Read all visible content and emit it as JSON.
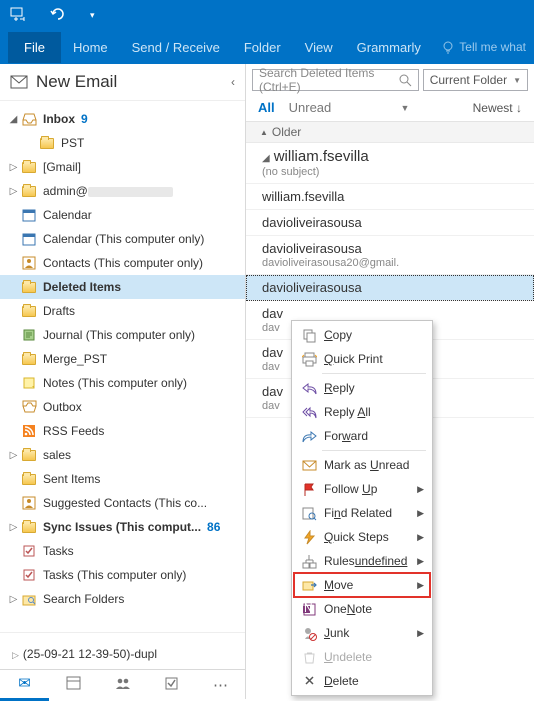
{
  "titlebar": {
    "undo_tip": "Undo",
    "dropdown_tip": "Customize"
  },
  "ribbon": {
    "tabs": {
      "file": "File",
      "home": "Home",
      "sendreceive": "Send / Receive",
      "folder": "Folder",
      "view": "View",
      "grammarly": "Grammarly"
    },
    "tell": "Tell me what"
  },
  "nav": {
    "new_email": "New Email",
    "tree": [
      {
        "id": "inbox",
        "label": "Inbox",
        "badge": "9",
        "depth": 0,
        "twisty": "down",
        "icon": "inbox",
        "bold": true
      },
      {
        "id": "pst",
        "label": "PST",
        "depth": 1,
        "icon": "folder"
      },
      {
        "id": "gmail",
        "label": "[Gmail]",
        "depth": 0,
        "twisty": "right",
        "icon": "folder"
      },
      {
        "id": "admin",
        "label": "admin@",
        "depth": 0,
        "twisty": "right",
        "icon": "folder",
        "redact": 85
      },
      {
        "id": "calendar",
        "label": "Calendar",
        "depth": 0,
        "icon": "calendar"
      },
      {
        "id": "calendar-tco",
        "label": "Calendar (This computer only)",
        "depth": 0,
        "icon": "calendar"
      },
      {
        "id": "contacts-tco",
        "label": "Contacts (This computer only)",
        "depth": 0,
        "icon": "contacts"
      },
      {
        "id": "deleted",
        "label": "Deleted Items",
        "depth": 0,
        "icon": "folder",
        "sel": true,
        "bold": true
      },
      {
        "id": "drafts",
        "label": "Drafts",
        "depth": 0,
        "icon": "folder"
      },
      {
        "id": "journal",
        "label": "Journal (This computer only)",
        "depth": 0,
        "icon": "journal"
      },
      {
        "id": "merge",
        "label": "Merge_PST",
        "depth": 0,
        "icon": "folder"
      },
      {
        "id": "notes",
        "label": "Notes (This computer only)",
        "depth": 0,
        "icon": "notes"
      },
      {
        "id": "outbox",
        "label": "Outbox",
        "depth": 0,
        "icon": "outbox"
      },
      {
        "id": "rss",
        "label": "RSS Feeds",
        "depth": 0,
        "icon": "rss"
      },
      {
        "id": "sales",
        "label": "sales",
        "depth": 0,
        "twisty": "right",
        "icon": "folder"
      },
      {
        "id": "sent",
        "label": "Sent Items",
        "depth": 0,
        "icon": "folder"
      },
      {
        "id": "suggested",
        "label": "Suggested Contacts (This co...",
        "depth": 0,
        "icon": "contacts"
      },
      {
        "id": "sync",
        "label": "Sync Issues (This comput...",
        "badge": "86",
        "depth": 0,
        "twisty": "right",
        "icon": "folder",
        "bold": true
      },
      {
        "id": "tasks",
        "label": "Tasks",
        "depth": 0,
        "icon": "tasks"
      },
      {
        "id": "tasks-tco",
        "label": "Tasks (This computer only)",
        "depth": 0,
        "icon": "tasks"
      },
      {
        "id": "search-folders",
        "label": "Search Folders",
        "depth": 0,
        "twisty": "right",
        "icon": "search-folder"
      }
    ],
    "account": "(25-09-21 12-39-50)-dupl"
  },
  "search": {
    "placeholder": "Search Deleted Items (Ctrl+E)",
    "scope": "Current Folder"
  },
  "filters": {
    "all": "All",
    "unread": "Unread",
    "sort": "Newest",
    "sort_arrow": "↓"
  },
  "group": "Older",
  "messages": [
    {
      "from": "william.fsevilla <w;  ...",
      "subj": "(no subject)",
      "top": true,
      "twisty": "down"
    },
    {
      "from": "william.fsevilla <w"
    },
    {
      "from": "davioliveirasousa <davioli..."
    },
    {
      "from": "davioliveirasousa <davioli...",
      "subj": "davioliveirasousa20@gmail."
    },
    {
      "from": "davioliveirasousa <davioli",
      "sel": true
    },
    {
      "from": "dav",
      "partial": "dav"
    },
    {
      "from": "dav",
      "partial": "dav"
    },
    {
      "from": "dav",
      "partial": "dav"
    }
  ],
  "context": [
    {
      "id": "copy",
      "label": "Copy",
      "u": 0,
      "icon": "copy"
    },
    {
      "id": "quickprint",
      "label": "Quick Print",
      "u": 0,
      "icon": "print"
    },
    {
      "sep": true
    },
    {
      "id": "reply",
      "label": "Reply",
      "u": 0,
      "icon": "reply"
    },
    {
      "id": "replyall",
      "label": "Reply All",
      "u": 6,
      "icon": "replyall"
    },
    {
      "id": "forward",
      "label": "Forward",
      "u": 3,
      "icon": "forward"
    },
    {
      "sep": true
    },
    {
      "id": "markunread",
      "label": "Mark as Unread",
      "u": 8,
      "icon": "envelope-closed"
    },
    {
      "id": "followup",
      "label": "Follow Up",
      "u": 7,
      "icon": "flag",
      "sub": true
    },
    {
      "id": "findrelated",
      "label": "Find Related",
      "u": 2,
      "icon": "find",
      "sub": true
    },
    {
      "id": "quicksteps",
      "label": "Quick Steps",
      "u": 0,
      "icon": "quicksteps",
      "sub": true
    },
    {
      "id": "rules",
      "label": "Rules",
      "u": 5,
      "icon": "rules",
      "sub": true
    },
    {
      "id": "move",
      "label": "Move",
      "u": 0,
      "icon": "move",
      "sub": true,
      "hl": true
    },
    {
      "id": "onenote",
      "label": "OneNote",
      "u": 3,
      "icon": "onenote"
    },
    {
      "id": "junk",
      "label": "Junk",
      "u": 0,
      "icon": "junk",
      "sub": true
    },
    {
      "id": "undelete",
      "label": "Undelete",
      "u": 0,
      "icon": "undelete",
      "dis": true
    },
    {
      "id": "delete",
      "label": "Delete",
      "u": 0,
      "icon": "delete"
    }
  ]
}
